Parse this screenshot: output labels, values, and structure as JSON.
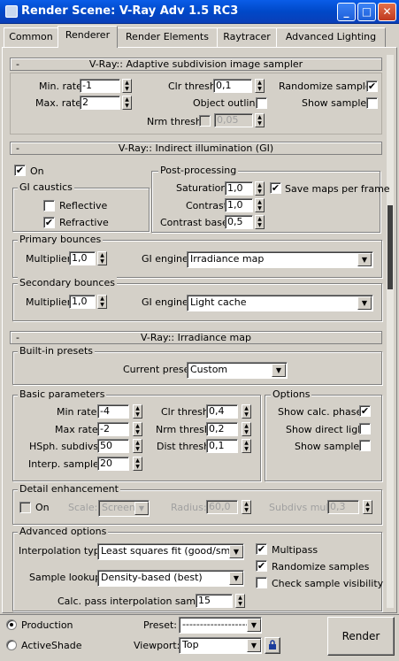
{
  "window": {
    "title": "Render Scene: V-Ray Adv 1.5 RC3",
    "min": "_",
    "max": "□",
    "close": "✕"
  },
  "tabs": [
    "Common",
    "Renderer",
    "Render Elements",
    "Raytracer",
    "Advanced Lighting"
  ],
  "selected_tab": "Renderer",
  "sampler": {
    "header": "V-Ray:: Adaptive subdivision image sampler",
    "collapse": "-",
    "min_rate_label": "Min. rate:",
    "min_rate": "-1",
    "max_rate_label": "Max. rate:",
    "max_rate": "2",
    "clr_thresh_label": "Clr thresh:",
    "clr_thresh": "0,1",
    "object_outline_label": "Object outline",
    "nrm_thresh_label": "Nrm thresh:",
    "nrm_thresh": "0,05",
    "randomize_label": "Randomize samples",
    "randomize": "✔",
    "show_samples_label": "Show samples"
  },
  "gi": {
    "header": "V-Ray:: Indirect illumination (GI)",
    "collapse": "-",
    "on_label": "On",
    "on": "✔",
    "caustics_group": "GI caustics",
    "reflective_label": "Reflective",
    "refractive_label": "Refractive",
    "refractive": "✔",
    "post_group": "Post-processing",
    "saturation_label": "Saturation:",
    "saturation": "1,0",
    "save_maps_label": "Save maps per frame",
    "save_maps": "✔",
    "contrast_label": "Contrast:",
    "contrast": "1,0",
    "contrast_base_label": "Contrast base:",
    "contrast_base": "0,5",
    "primary_group": "Primary bounces",
    "primary_mult_label": "Multiplier:",
    "primary_mult": "1,0",
    "primary_engine_label": "GI engine:",
    "primary_engine": "Irradiance map",
    "secondary_group": "Secondary bounces",
    "secondary_mult_label": "Multiplier:",
    "secondary_mult": "1,0",
    "secondary_engine_label": "GI engine:",
    "secondary_engine": "Light cache"
  },
  "irr": {
    "header": "V-Ray:: Irradiance map",
    "collapse": "-",
    "presets_group": "Built-in presets",
    "current_preset_label": "Current preset:",
    "current_preset": "Custom",
    "basic_group": "Basic parameters",
    "min_rate_label": "Min rate:",
    "min_rate": "-4",
    "max_rate_label": "Max rate:",
    "max_rate": "-2",
    "hsph_label": "HSph. subdivs:",
    "hsph": "50",
    "interp_label": "Interp. samples:",
    "interp": "20",
    "clr_label": "Clr thresh:",
    "clr": "0,4",
    "nrm_label": "Nrm thresh:",
    "nrm": "0,2",
    "dist_label": "Dist thresh:",
    "dist": "0,1",
    "options_group": "Options",
    "show_calc_label": "Show calc. phase",
    "show_calc": "✔",
    "show_direct_label": "Show direct light",
    "show_samples_label": "Show samples",
    "detail_group": "Detail enhancement",
    "detail_on_label": "On",
    "scale_label": "Scale:",
    "scale": "Screen",
    "radius_label": "Radius:",
    "radius": "60,0",
    "subdivs_mult_label": "Subdivs mult.",
    "subdivs_mult": "0,3",
    "advanced_group": "Advanced options",
    "interp_type_label": "Interpolation type:",
    "interp_type": "Least squares fit (good/smooth",
    "multipass_label": "Multipass",
    "multipass": "✔",
    "randomize_label": "Randomize samples",
    "randomize": "✔",
    "sample_lookup_label": "Sample lookup:",
    "sample_lookup": "Density-based (best)",
    "check_vis_label": "Check sample visibility",
    "calc_pass_label": "Calc. pass interpolation samples:",
    "calc_pass": "15"
  },
  "bottom": {
    "production_label": "Production",
    "activeshade_label": "ActiveShade",
    "preset_label": "Preset:",
    "preset": "-------------------------",
    "viewport_label": "Viewport:",
    "viewport": "Top",
    "render_label": "Render"
  }
}
